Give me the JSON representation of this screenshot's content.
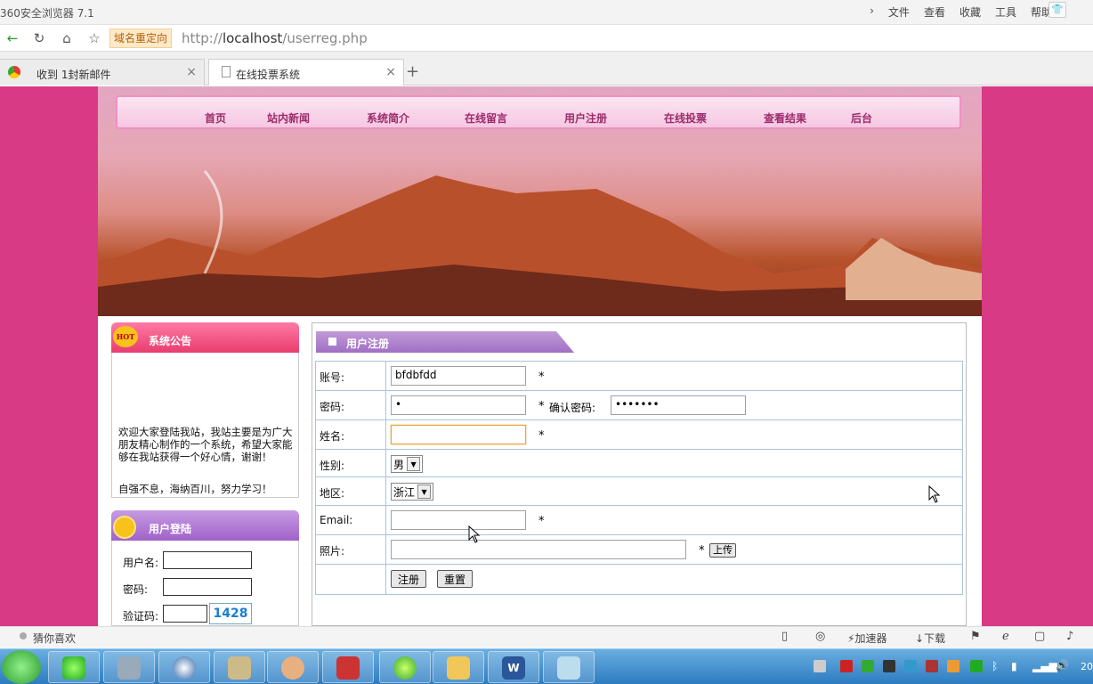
{
  "browser": {
    "title": "360安全浏览器 7.1",
    "menu": [
      "文件",
      "查看",
      "收藏",
      "工具",
      "帮助"
    ],
    "redirect_label": "域名重定向",
    "url_prefix": "http://",
    "url_host": "localhost",
    "url_path": "/userreg.php",
    "tabs": [
      {
        "label": "收到 1封新邮件",
        "active": false
      },
      {
        "label": "在线投票系统",
        "active": true
      }
    ],
    "new_tab": "+"
  },
  "site": {
    "nav": [
      "首页",
      "站内新闻",
      "系统简介",
      "在线留言",
      "用户注册",
      "在线投票",
      "查看结果",
      "后台"
    ],
    "notice": {
      "badge": "HOT",
      "title": "系统公告",
      "text1": "欢迎大家登陆我站，我站主要是为广大朋友精心制作的一个系统，希望大家能够在我站获得一个好心情，谢谢！",
      "text2": "自强不息，海纳百川，努力学习！"
    },
    "login": {
      "title": "用户登陆",
      "username_label": "用户名:",
      "password_label": "密码:",
      "captcha_label": "验证码:",
      "captcha_value": "1428"
    },
    "register": {
      "title": "用户注册",
      "account_label": "账号:",
      "account_value": "bfdbfdd",
      "password_label": "密码:",
      "password_value": "•",
      "confirm_label": "确认密码:",
      "confirm_value": "•••••••",
      "name_label": "姓名:",
      "name_value": "",
      "gender_label": "性别:",
      "gender_value": "男",
      "region_label": "地区:",
      "region_value": "浙江",
      "email_label": "Email:",
      "email_value": "",
      "photo_label": "照片:",
      "upload_label": "上传",
      "required_mark": "*",
      "submit_label": "注册",
      "reset_label": "重置"
    }
  },
  "statusbar": {
    "left": "猜你喜欢",
    "accelerator": "加速器",
    "download": "下载"
  },
  "taskbar": {
    "clock": "20"
  },
  "colors": {
    "page_bg": "#d83a85",
    "nav_text": "#9c2b6b",
    "notice_head": "#e83d6f",
    "login_head": "#a070c4",
    "captcha": "#1a7fd1"
  }
}
